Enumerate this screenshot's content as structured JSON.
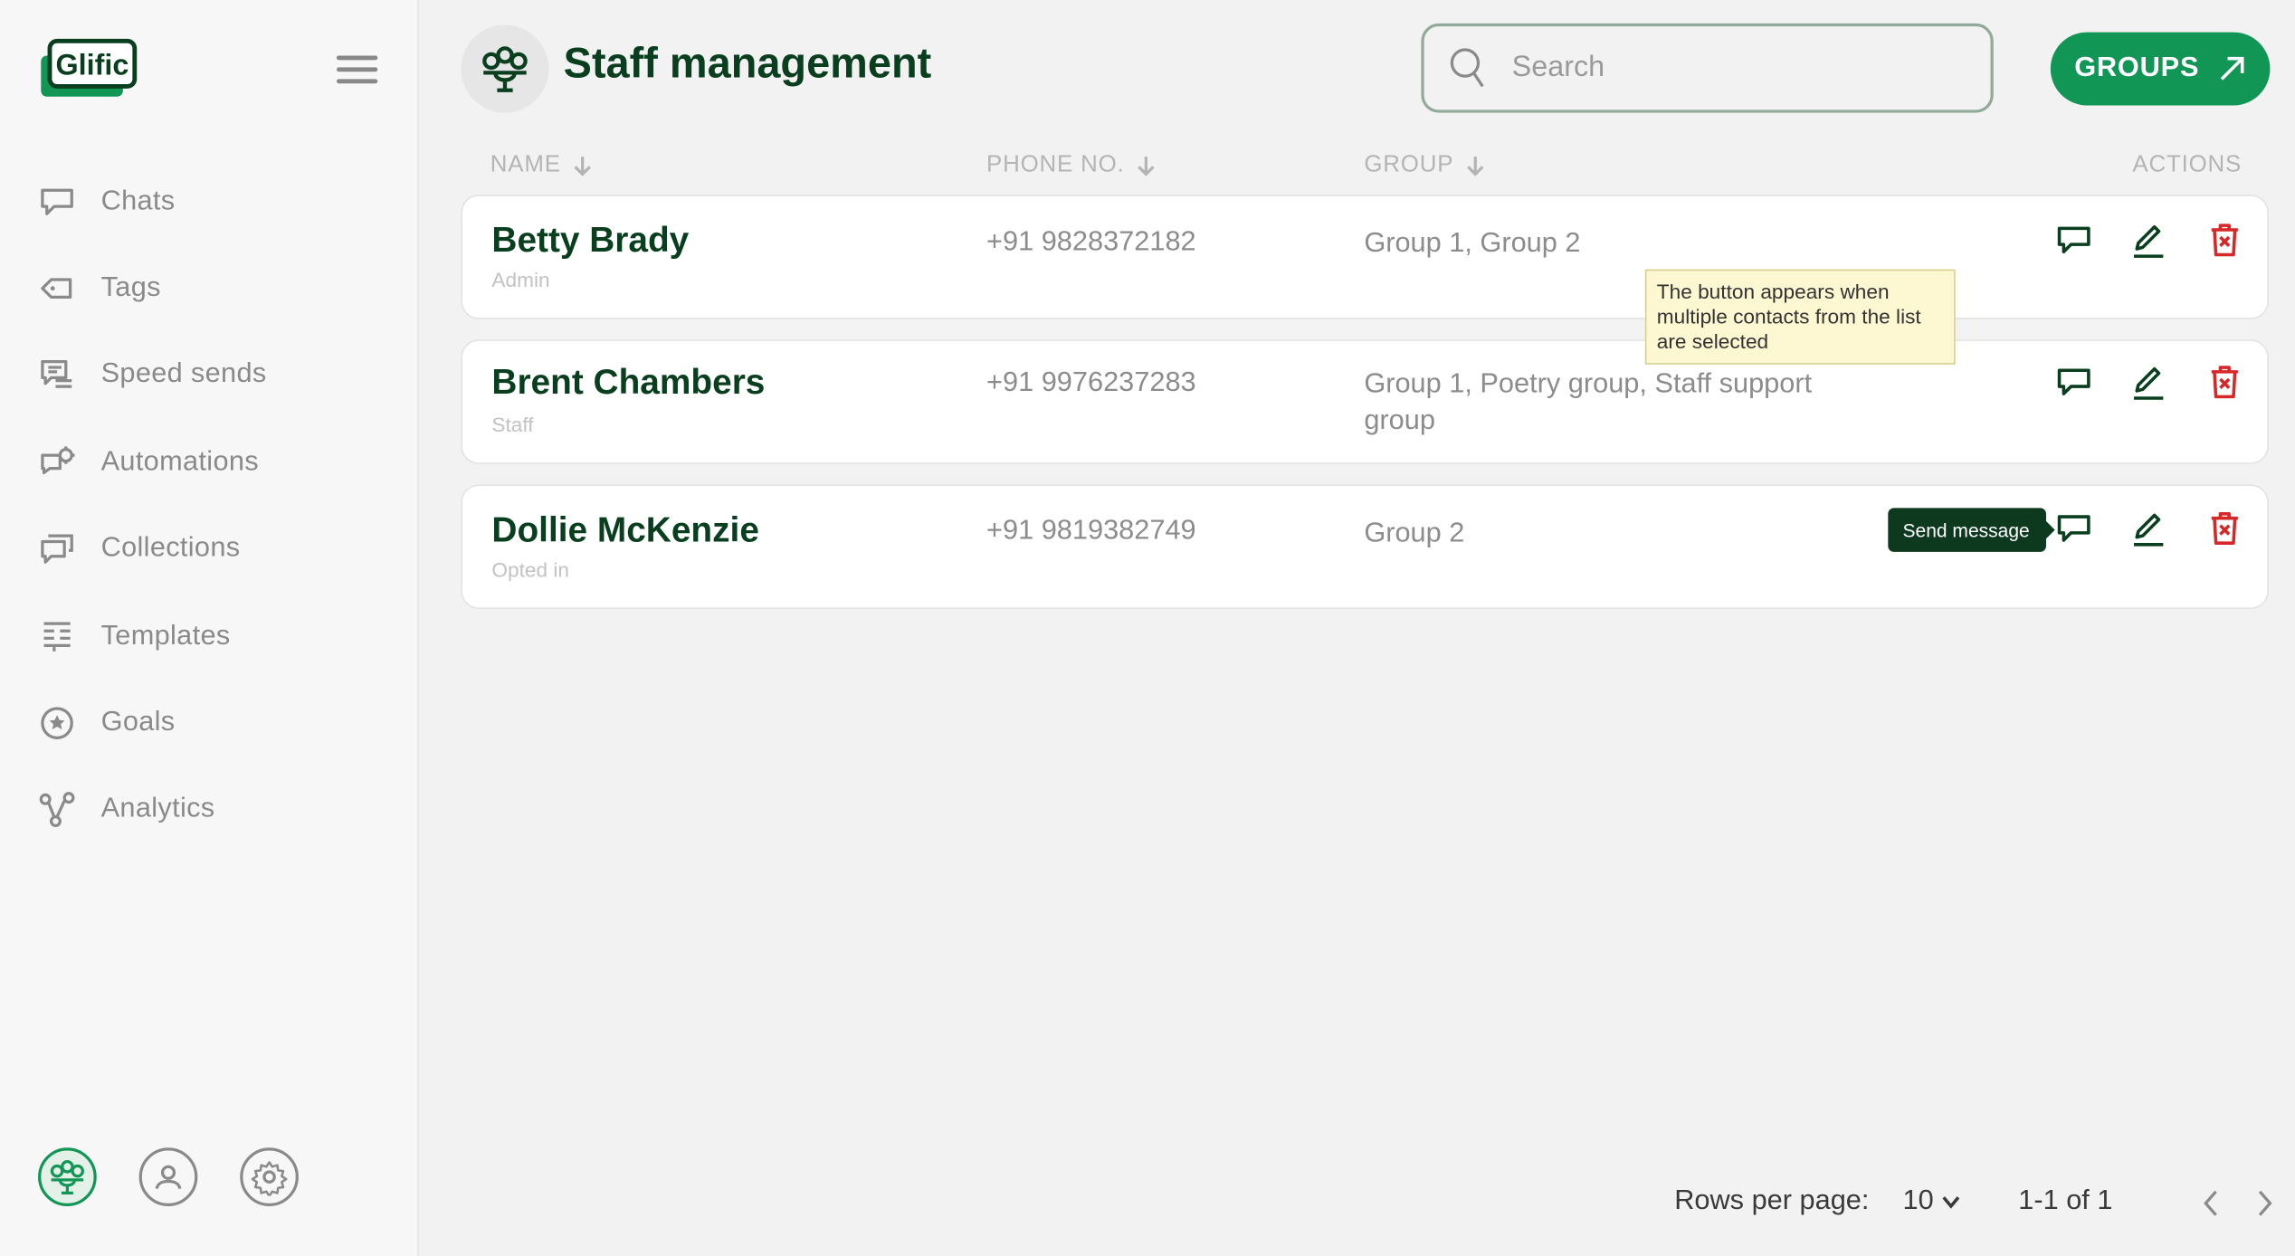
{
  "app": {
    "logo_text": "Glific",
    "accent": "#119656",
    "dark_green": "#093f1e",
    "danger": "#d62828"
  },
  "sidebar": {
    "items": [
      {
        "label": "Chats",
        "icon": "chat-icon"
      },
      {
        "label": "Tags",
        "icon": "tag-icon"
      },
      {
        "label": "Speed sends",
        "icon": "speed-sends-icon"
      },
      {
        "label": "Automations",
        "icon": "automation-icon"
      },
      {
        "label": "Collections",
        "icon": "collections-icon"
      },
      {
        "label": "Templates",
        "icon": "templates-icon"
      },
      {
        "label": "Goals",
        "icon": "goals-icon"
      },
      {
        "label": "Analytics",
        "icon": "analytics-icon"
      }
    ],
    "bottom_icons": [
      "staff-icon",
      "profile-icon",
      "settings-icon"
    ]
  },
  "header": {
    "title": "Staff management",
    "search_placeholder": "Search",
    "groups_button": "GROUPS"
  },
  "table": {
    "columns": [
      "NAME",
      "PHONE NO.",
      "GROUP",
      "ACTIONS"
    ],
    "rows": [
      {
        "name": "Betty Brady",
        "role": "Admin",
        "phone": "+91 9828372182",
        "group": "Group 1, Group 2"
      },
      {
        "name": "Brent Chambers",
        "role": "Staff",
        "phone": "+91 9976237283",
        "group": "Group 1, Poetry group, Staff support group"
      },
      {
        "name": "Dollie McKenzie",
        "role": "Opted in",
        "phone": "+91 9819382749",
        "group": "Group 2"
      }
    ]
  },
  "tooltips": {
    "note": "The button appears when multiple contacts from the list are selected",
    "send_message": "Send message"
  },
  "pagination": {
    "rows_per_page_label": "Rows per page:",
    "rows_per_page_value": "10",
    "range": "1-1 of 1"
  }
}
